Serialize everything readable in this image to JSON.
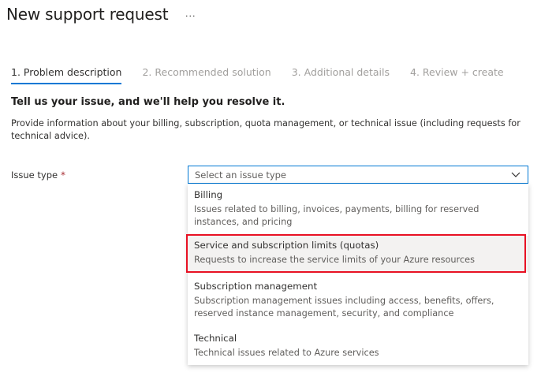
{
  "header": {
    "title": "New support request",
    "more_label": "···"
  },
  "tabs": [
    {
      "label": "1. Problem description",
      "active": true
    },
    {
      "label": "2. Recommended solution",
      "active": false
    },
    {
      "label": "3. Additional details",
      "active": false
    },
    {
      "label": "4. Review + create",
      "active": false
    }
  ],
  "section": {
    "heading": "Tell us your issue, and we'll help you resolve it.",
    "description": "Provide information about your billing, subscription, quota management, or technical issue (including requests for technical advice)."
  },
  "issue_type": {
    "label": "Issue type",
    "required_marker": "*",
    "placeholder": "Select an issue type",
    "chevron_icon": "chevron-down-icon",
    "options": [
      {
        "title": "Billing",
        "description": "Issues related to billing, invoices, payments, billing for reserved instances, and pricing"
      },
      {
        "title": "Service and subscription limits (quotas)",
        "description": "Requests to increase the service limits of your Azure resources",
        "highlighted": true
      },
      {
        "title": "Subscription management",
        "description": "Subscription management issues including access, benefits, offers, reserved instance management, security, and compliance"
      },
      {
        "title": "Technical",
        "description": "Technical issues related to Azure services"
      }
    ]
  },
  "colors": {
    "accent": "#0078d4",
    "highlight": "#e81123",
    "required": "#a4262c"
  }
}
